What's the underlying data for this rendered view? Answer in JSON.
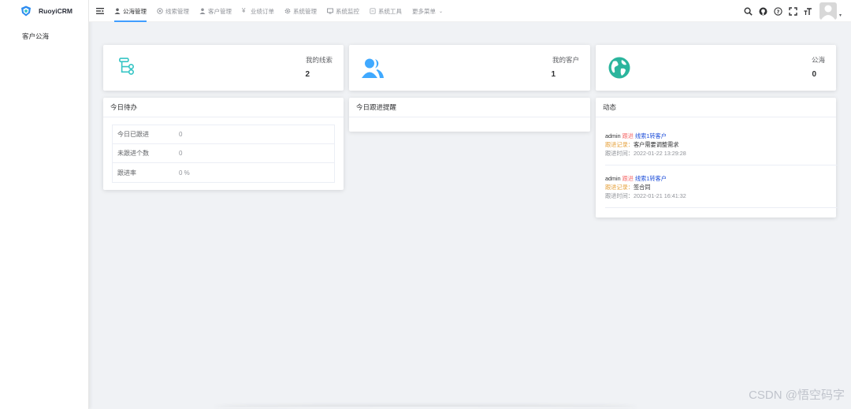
{
  "app": {
    "name": "RuoyiCRM"
  },
  "sidebar": {
    "items": [
      {
        "label": "客户公海"
      }
    ]
  },
  "nav": {
    "items": [
      {
        "label": "公海管理",
        "icon": "user-icon",
        "active": true
      },
      {
        "label": "线索管理",
        "icon": "target-icon",
        "active": false
      },
      {
        "label": "客户管理",
        "icon": "person-icon",
        "active": false
      },
      {
        "label": "业绩订单",
        "icon": "yen-icon",
        "active": false
      },
      {
        "label": "系统管理",
        "icon": "gear-icon",
        "active": false
      },
      {
        "label": "系统监控",
        "icon": "monitor-icon",
        "active": false
      },
      {
        "label": "系统工具",
        "icon": "tool-icon",
        "active": false
      },
      {
        "label": "更多菜单",
        "icon": "",
        "active": false
      }
    ],
    "tools": [
      "search-icon",
      "github-icon",
      "help-icon",
      "fullscreen-icon",
      "font-size-icon"
    ]
  },
  "stats": [
    {
      "label": "我的线索",
      "value": "2",
      "icon": "tree-icon",
      "color": "#36c5c5"
    },
    {
      "label": "我的客户",
      "value": "1",
      "icon": "people-icon",
      "color": "#40a9ff"
    },
    {
      "label": "公海",
      "value": "0",
      "icon": "globe-icon",
      "color": "#2bb59d"
    }
  ],
  "todo": {
    "title": "今日待办",
    "rows": [
      {
        "label": "今日已跟进",
        "value": "0"
      },
      {
        "label": "未跟进个数",
        "value": "0"
      },
      {
        "label": "跟进率",
        "value": "0 %"
      }
    ]
  },
  "reminder": {
    "title": "今日跟进提醒"
  },
  "activity": {
    "title": "动态",
    "items": [
      {
        "user": "admin",
        "action": "跟进",
        "target": "线索1转客户",
        "record_label": "跟进记录：",
        "record": "客户需要调整需求",
        "time_label": "跟进时间：",
        "time": "2022-01-22 13:29:28"
      },
      {
        "user": "admin",
        "action": "跟进",
        "target": "线索1转客户",
        "record_label": "跟进记录：",
        "record": "签合同",
        "time_label": "跟进时间：",
        "time": "2022-01-21 16:41:32"
      }
    ]
  },
  "watermark": "CSDN @悟空码字"
}
